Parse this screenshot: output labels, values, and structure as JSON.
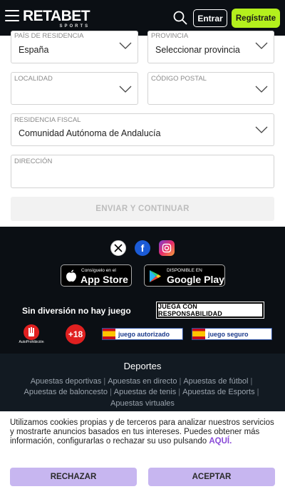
{
  "header": {
    "logo": "RETABET",
    "logo_sub": "SPORTS",
    "login_label": "Entrar",
    "register_label": "Regístrate",
    "colors": {
      "bar": "#0b0f14",
      "register_bg": "#b4f01d"
    }
  },
  "form": {
    "country": {
      "label": "PAÍS DE RESIDENCIA",
      "value": "España"
    },
    "province": {
      "label": "PROVINCIA",
      "value": "Seleccionar provincia"
    },
    "locality": {
      "label": "LOCALIDAD",
      "value": ""
    },
    "postal": {
      "label": "CÓDIGO POSTAL",
      "value": ""
    },
    "fiscal": {
      "label": "RESIDENCIA FISCAL",
      "value": "Comunidad Autónoma de Andalucía"
    },
    "address": {
      "label": "DIRECCIÓN",
      "value": ""
    },
    "submit_label": "ENVIAR Y CONTINUAR"
  },
  "footer": {
    "social": [
      "x-icon",
      "facebook-icon",
      "instagram-icon"
    ],
    "appstore": {
      "small": "Consíguelo en el",
      "big": "App Store"
    },
    "googleplay": {
      "small": "DISPONIBLE EN",
      "big": "Google Play"
    },
    "no_fun": "Sin diversión no hay juego",
    "responsible": "JUEGA CON RESPONSABILIDAD",
    "autoprohibicion": "AutoProhibición",
    "plus18": "+18",
    "juego_autorizado": "juego autorizado",
    "juego_seguro": "juego seguro",
    "sports_title": "Deportes",
    "links": {
      "l1": "Apuestas deportivas",
      "l2": "Apuestas en directo",
      "l3": "Apuestas de fútbol",
      "l4": "Apuestas de baloncesto",
      "l5": "Apuestas de tenis",
      "l6": "Apuestas de Esports",
      "l7": "Apuestas virtuales"
    }
  },
  "cookie": {
    "text": "Utilizamos cookies propias y de terceros para analizar nuestros servicios y mostrarte anuncios basados en tus intereses. Puedes obtener más información, configurarlas o rechazar su uso pulsando",
    "link": "AQUÍ.",
    "reject_label": "RECHAZAR",
    "accept_label": "ACEPTAR",
    "button_color": "#c7b6f0"
  }
}
